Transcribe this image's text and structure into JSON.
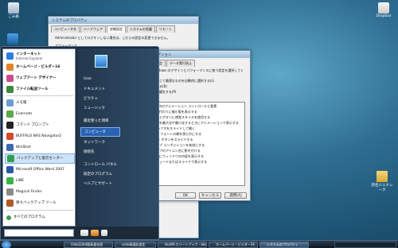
{
  "desktop": {
    "icons": [
      {
        "label": "ごみ箱",
        "name": "recycle-bin"
      },
      {
        "label": "Dropbox",
        "name": "dropbox"
      },
      {
        "label": "宛名ジェネレータ",
        "name": "folder"
      }
    ]
  },
  "sys_props": {
    "title": "システムのプロパティ",
    "tabs": [
      "コンピュータ名",
      "ハードウェア",
      "詳細設定",
      "システムの保護",
      "リモート"
    ],
    "text1": "Administrator としてログオンしない場合は、これらの設定の変更できません。",
    "text2": "パフォーマンス"
  },
  "perf_opts": {
    "title": "パフォーマンス オプション",
    "tabs": [
      "視覚効果",
      "詳細設定",
      "データ実行防止"
    ],
    "desc": "コンピュータの Windows のデザインとパフォーマンスに使う設定を選択してください。",
    "radios": [
      "コンピュータに応じて最適なものを自動的に選択する(L)",
      "デザインを優先する(B)",
      "パフォーマンスを優先する(P)",
      "カスタム(C):"
    ],
    "checks": [
      "Windows 内のアニメーション コントロールと要素",
      "アイコンの代わりに縮小版を表示する",
      "ウィンドウとボタンに視覚スタイルを使用する",
      "ウィンドウを最大化や最小化するときにアニメーションで表示する",
      "コンボ ボックスをスライドして開く",
      "スクリーン フォントの縁を滑らかにする",
      "タスク バー ボタンをスライドする",
      "デスクトップ コンポジションを有効にする",
      "デスクトップのアイコン名に影を付ける",
      "ドラッグ中にウィンドウの内容を表示する",
      "ヒントをフェードまたはスライドで表示する"
    ],
    "ok": "OK",
    "cancel": "キャンセル",
    "apply": "適用(A)"
  },
  "start_menu": {
    "left": [
      {
        "title": "インターネット",
        "sub": "Internet Explorer",
        "color": "#2a7de1"
      },
      {
        "title": "ホームページ・ビルダー16",
        "sub": "",
        "color": "#e0832a"
      },
      {
        "title": "ウェブアート デザイナー",
        "sub": "",
        "color": "#d04a8a"
      },
      {
        "title": "ファイル転送ツール",
        "sub": "",
        "color": "#3a8a3a"
      },
      {
        "title": "",
        "sub": "メモ帳",
        "color": "#6a9fd0"
      },
      {
        "title": "",
        "sub": "Evernote",
        "color": "#5aa847"
      },
      {
        "title": "",
        "sub": "コマンド プロンプト",
        "color": "#222222"
      },
      {
        "title": "",
        "sub": "BUFFALO NAS Navigator2",
        "color": "#d24a2a"
      },
      {
        "title": "",
        "sub": "WinShot",
        "color": "#3a6ab0"
      },
      {
        "title": "",
        "sub": "バックアップと復元センター",
        "color": "#2f9e4f"
      },
      {
        "title": "",
        "sub": "Microsoft Office Word 2007",
        "color": "#2b58a8"
      },
      {
        "title": "",
        "sub": "LINE",
        "color": "#3bb34a"
      },
      {
        "title": "",
        "sub": "Magical Finder",
        "color": "#8a8a8a"
      },
      {
        "title": "",
        "sub": "楽々バックアップ ツール",
        "color": "#b05a2a"
      }
    ],
    "all_programs": "すべてのプログラム",
    "search_placeholder": "",
    "right": [
      "User",
      "ドキュメント",
      "ピクチャ",
      "ミュージック",
      "最近使った項目",
      "コンピュータ",
      "ネットワーク",
      "接続先",
      "コントロール パネル",
      "既定のプログラム",
      "ヘルプとサポート"
    ]
  },
  "taskbar": {
    "buttons": [
      "Vista32bit版高速化設",
      "vista高速化設定",
      "dsc09-カリートブック - dec",
      "ホームページ・ビルダー16",
      "システムのプロパティ"
    ]
  }
}
